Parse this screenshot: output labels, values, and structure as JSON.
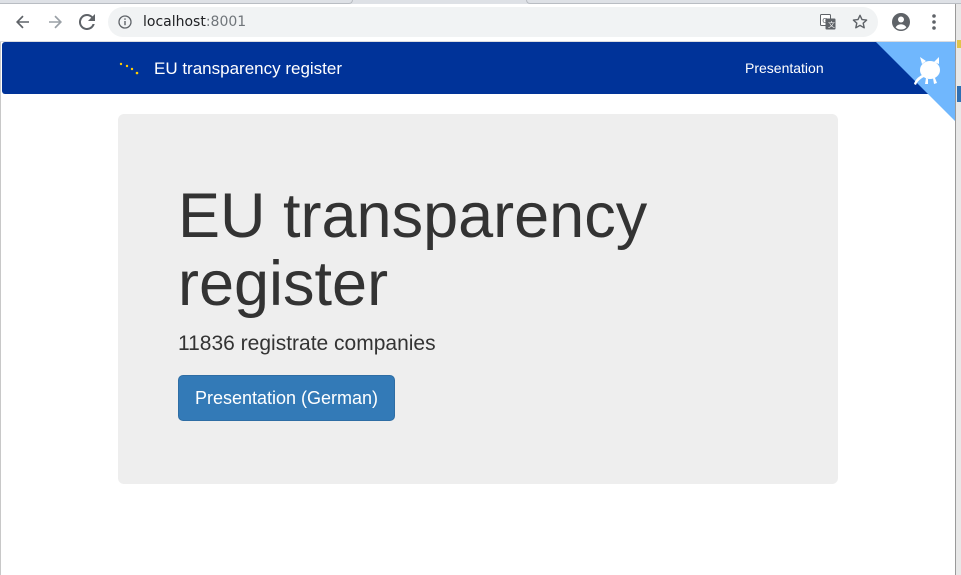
{
  "browser": {
    "url_host": "localhost",
    "url_port": ":8001",
    "icons": {
      "back": "back-arrow-icon",
      "forward": "forward-arrow-icon",
      "reload": "reload-icon",
      "site_info": "info-icon",
      "translate": "translate-icon",
      "bookmark": "star-icon",
      "account": "account-icon",
      "menu": "kebab-menu-icon"
    }
  },
  "navbar": {
    "brand": "EU transparency register",
    "links": [
      {
        "label": "Presentation"
      }
    ],
    "background_color": "#003399",
    "fork_corner_color": "#70b7fd"
  },
  "jumbotron": {
    "title": "EU transparency register",
    "subtitle": "11836 registrate companies",
    "button_label": "Presentation (German)",
    "background_color": "#eeeeee",
    "button_color": "#337ab7"
  }
}
